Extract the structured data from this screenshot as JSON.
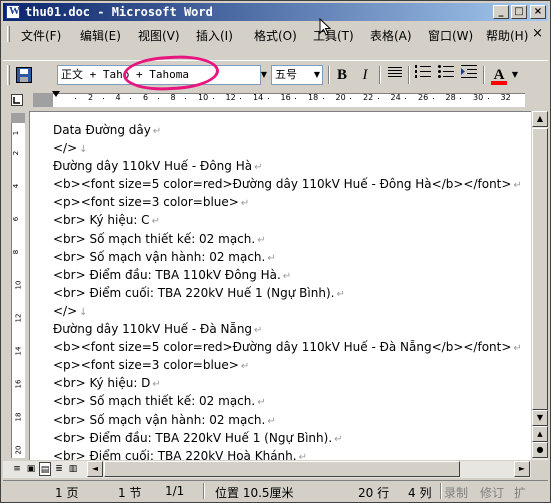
{
  "window": {
    "title": "thu01.doc - Microsoft Word",
    "minimize": "_",
    "maximize": "□",
    "close": "×"
  },
  "menu": {
    "items": [
      "文件(F)",
      "编辑(E)",
      "视图(V)",
      "插入(I)",
      "格式(O)",
      "工具(T)",
      "表格(A)",
      "窗口(W)",
      "帮助(H)"
    ],
    "close_glyph": "×"
  },
  "toolbar": {
    "style_value": "正文 + Taho + Tahoma",
    "font_size_value": "五号",
    "bold": "B",
    "italic": "I",
    "font_color_label": "A",
    "highlight_color": "#e8157f",
    "font_color": "#ff0000"
  },
  "ruler": {
    "marks": [
      "2",
      "4",
      "6",
      "8",
      "10",
      "12",
      "14",
      "16",
      "18",
      "20",
      "22",
      "24",
      "26",
      "28",
      "30",
      "32",
      "34",
      "36",
      "38"
    ]
  },
  "vruler": {
    "marks": [
      "1",
      "2",
      "4",
      "6",
      "8",
      "10",
      "12",
      "14",
      "16",
      "18",
      "20"
    ]
  },
  "document": {
    "lines": [
      "Data Đường dây",
      "</>",
      "Đường dây 110kV Huế - Đông Hà",
      "<b><font size=5 color=red>Đường dây 110kV Huế - Đông Hà</b></font>",
      "<p><font size=3 color=blue>",
      "<br> Ký hiệu: C",
      "<br> Số mạch thiết kế: 02 mạch.",
      "<br> Số mạch vận hành: 02 mạch.",
      "<br> Điểm đầu: TBA 110kV Đông Hà.",
      "<br> Điểm cuối: TBA 220kV Huế 1 (Ngự Bình).",
      "</>",
      "Đường dây 110kV Huế - Đà Nẵng",
      "<b><font size=5 color=red>Đường dây 110kV Huế - Đà Nẵng</b></font>",
      "<p><font size=3 color=blue>",
      "<br> Ký hiệu: D",
      "<br> Số mạch thiết kế: 02 mạch.",
      "<br> Số mạch vận hành: 02 mạch.",
      "<br> Điểm đầu: TBA 220kV Huế 1 (Ngự Bình).",
      "<br> Điểm cuối: TBA 220kV Hoà Khánh.",
      "</>"
    ],
    "paragraph_mark": "↵",
    "line_break_mark": "↓"
  },
  "status": {
    "page": "1 页",
    "section": "1 节",
    "page_of": "1/1",
    "position": "位置 10.5厘米",
    "line": "20 行",
    "column": "4 列",
    "rec": "录制",
    "trk": "修订",
    "ext": "扩"
  }
}
